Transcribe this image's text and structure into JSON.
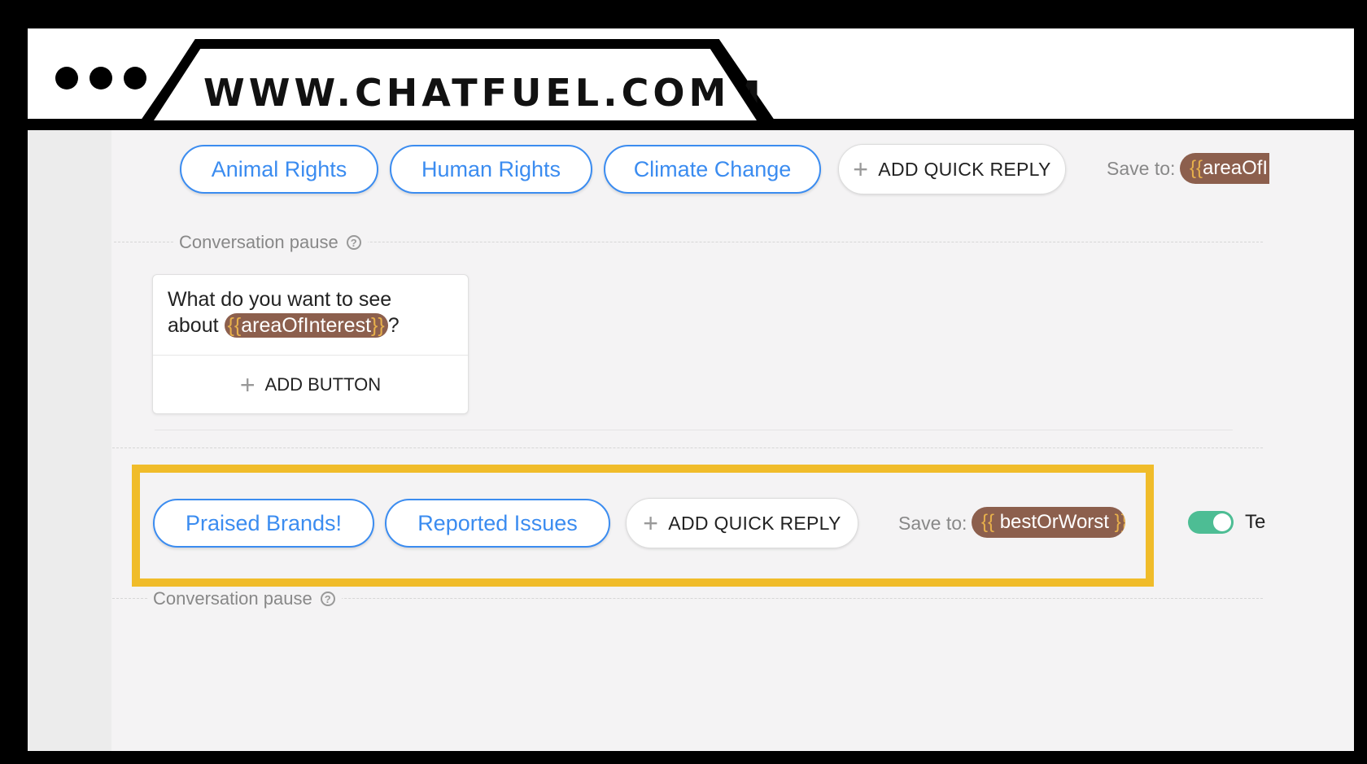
{
  "browser": {
    "url": "WWW.CHATFUEL.COM"
  },
  "block_top": {
    "quick_replies": [
      "Animal Rights",
      "Human Rights",
      "Climate Change"
    ],
    "add_quick_reply_label": "ADD QUICK REPLY",
    "save_to_label": "Save to:",
    "save_to_variable": "areaOfI"
  },
  "pause_top": {
    "label": "Conversation pause",
    "help_icon": "question-icon"
  },
  "text_card": {
    "text_before": "What do you want to see about ",
    "variable": "areaOfInterest",
    "text_after": "?",
    "add_button_label": "ADD BUTTON"
  },
  "block_bottom": {
    "quick_replies": [
      "Praised Brands!",
      "Reported Issues"
    ],
    "add_quick_reply_label": "ADD QUICK REPLY",
    "save_to_label": "Save to:",
    "save_to_variable": "bestOrWorst",
    "toggle_label": "Te",
    "toggle_on": true
  },
  "pause_bottom": {
    "label": "Conversation pause",
    "help_icon": "question-icon"
  },
  "colors": {
    "accent_blue": "#3b8cf0",
    "variable_chip": "#8c5f4d",
    "brace": "#e7b04b",
    "highlight": "#f0bc2a",
    "toggle": "#4dbd94"
  }
}
